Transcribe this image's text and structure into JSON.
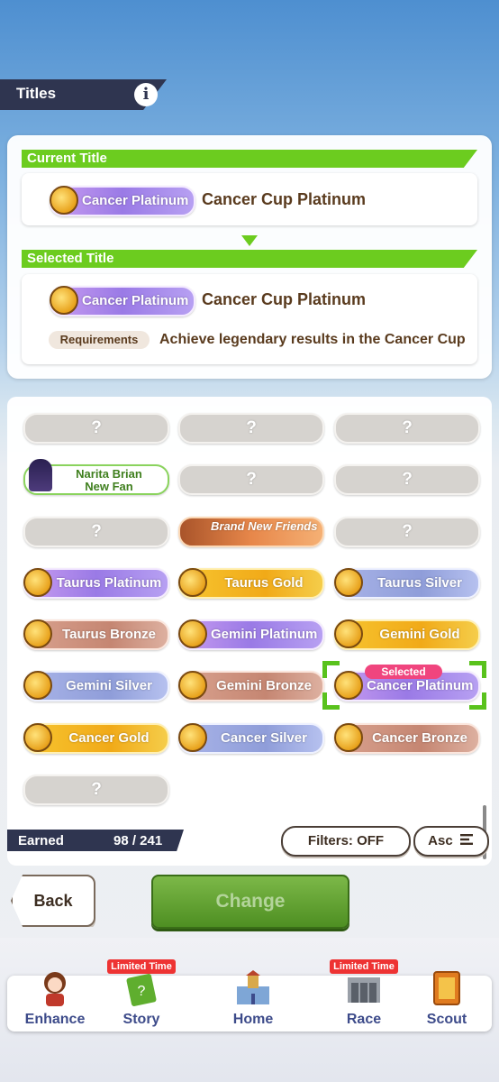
{
  "header": {
    "title": "Titles",
    "info_icon": "i"
  },
  "current": {
    "heading": "Current Title",
    "badge": "Cancer Platinum",
    "name": "Cancer Cup Platinum"
  },
  "selected": {
    "heading": "Selected Title",
    "badge": "Cancer Platinum",
    "name": "Cancer Cup Platinum",
    "requirements_label": "Requirements",
    "requirements_text": "Achieve legendary results in the Cancer Cup"
  },
  "grid": {
    "selected_tag": "Selected",
    "items": [
      {
        "label": "?",
        "style": "unknown"
      },
      {
        "label": "?",
        "style": "unknown"
      },
      {
        "label": "?",
        "style": "unknown"
      },
      {
        "label": "Narita Brian",
        "sub": "New Fan",
        "style": "narita"
      },
      {
        "label": "?",
        "style": "unknown"
      },
      {
        "label": "?",
        "style": "unknown"
      },
      {
        "label": "?",
        "style": "unknown"
      },
      {
        "label": "Brand New Friends",
        "style": "bnf"
      },
      {
        "label": "?",
        "style": "unknown"
      },
      {
        "label": "Taurus Platinum",
        "style": "plat"
      },
      {
        "label": "Taurus Gold",
        "style": "gold"
      },
      {
        "label": "Taurus Silver",
        "style": "silver"
      },
      {
        "label": "Taurus Bronze",
        "style": "bronze"
      },
      {
        "label": "Gemini Platinum",
        "style": "plat"
      },
      {
        "label": "Gemini Gold",
        "style": "gold"
      },
      {
        "label": "Gemini Silver",
        "style": "silver"
      },
      {
        "label": "Gemini Bronze",
        "style": "bronze"
      },
      {
        "label": "Cancer Platinum",
        "style": "plat"
      },
      {
        "label": "Cancer Gold",
        "style": "gold"
      },
      {
        "label": "Cancer Silver",
        "style": "silver"
      },
      {
        "label": "Cancer Bronze",
        "style": "bronze"
      },
      {
        "label": "?",
        "style": "unknown"
      }
    ]
  },
  "footer": {
    "earned_label": "Earned",
    "earned_count": "98 / 241",
    "filters": "Filters: OFF",
    "sort": "Asc"
  },
  "actions": {
    "back": "Back",
    "change": "Change"
  },
  "nav": {
    "items": [
      {
        "label": "Enhance",
        "icon": "character-icon",
        "limited": ""
      },
      {
        "label": "Story",
        "icon": "book-icon",
        "limited": "Limited Time"
      },
      {
        "label": "Home",
        "icon": "school-building-icon",
        "limited": ""
      },
      {
        "label": "Race",
        "icon": "race-gate-icon",
        "limited": "Limited Time"
      },
      {
        "label": "Scout",
        "icon": "scout-card-icon",
        "limited": ""
      }
    ]
  },
  "colors": {
    "accent_green": "#6ccc1f",
    "header_navy": "#2f3550",
    "selected_pink": "#f0457e"
  }
}
